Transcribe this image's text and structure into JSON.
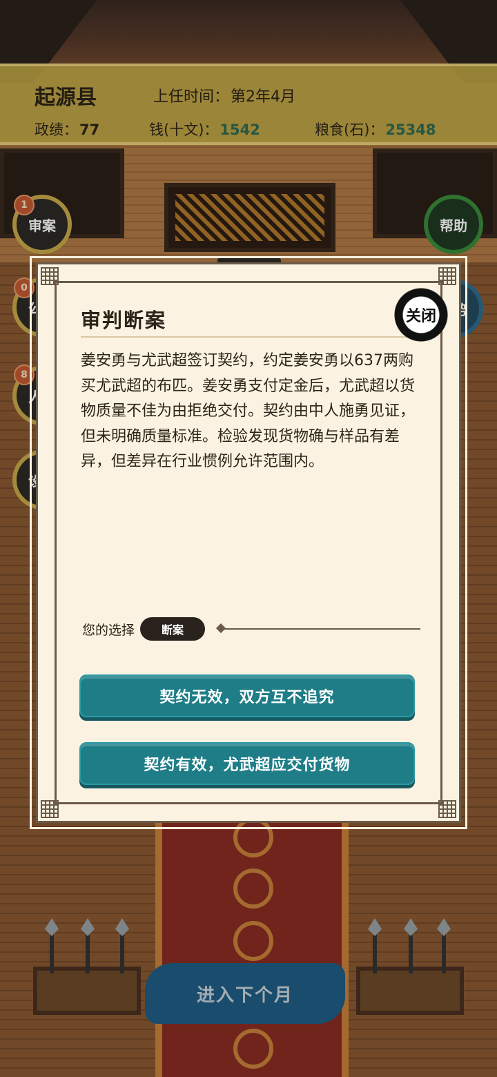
{
  "header": {
    "county": "起源县",
    "term_label": "上任时间：",
    "term_value": "第2年4月",
    "merit_label": "政绩：",
    "merit_value": "77",
    "money_label": "钱(十文)：",
    "money_value": "1542",
    "grain_label": "粮食(石)：",
    "grain_value": "25348"
  },
  "side_buttons": {
    "case": {
      "label": "审案",
      "badge": "1"
    },
    "affairs": {
      "label": "公务",
      "badge": "0"
    },
    "personnel": {
      "label": "人员",
      "badge": "8"
    },
    "settings": {
      "label": "设置"
    },
    "help": {
      "label": "帮助"
    },
    "situation": {
      "label": "局势"
    }
  },
  "next_month": "进入下个月",
  "modal": {
    "title": "审判断案",
    "close_label": "关闭",
    "case_text": "姜安勇与尤武超签订契约，约定姜安勇以637两购买尤武超的布匹。姜安勇支付定金后，尤武超以货物质量不佳为由拒绝交付。契约由中人施勇见证，但未明确质量标准。检验发现货物确与样品有差异，但差异在行业惯例允许范围内。",
    "choice_label": "您的选择",
    "choice_value": "断案",
    "options": [
      {
        "label": "契约无效，双方互不追究"
      },
      {
        "label": "契约有效，尤武超应交付货物"
      }
    ]
  },
  "colors": {
    "status_bar": "#c4aa48",
    "modal_bg": "#fbf2e2",
    "option_btn": "#1e7d87",
    "money_green": "#2f6b52"
  }
}
